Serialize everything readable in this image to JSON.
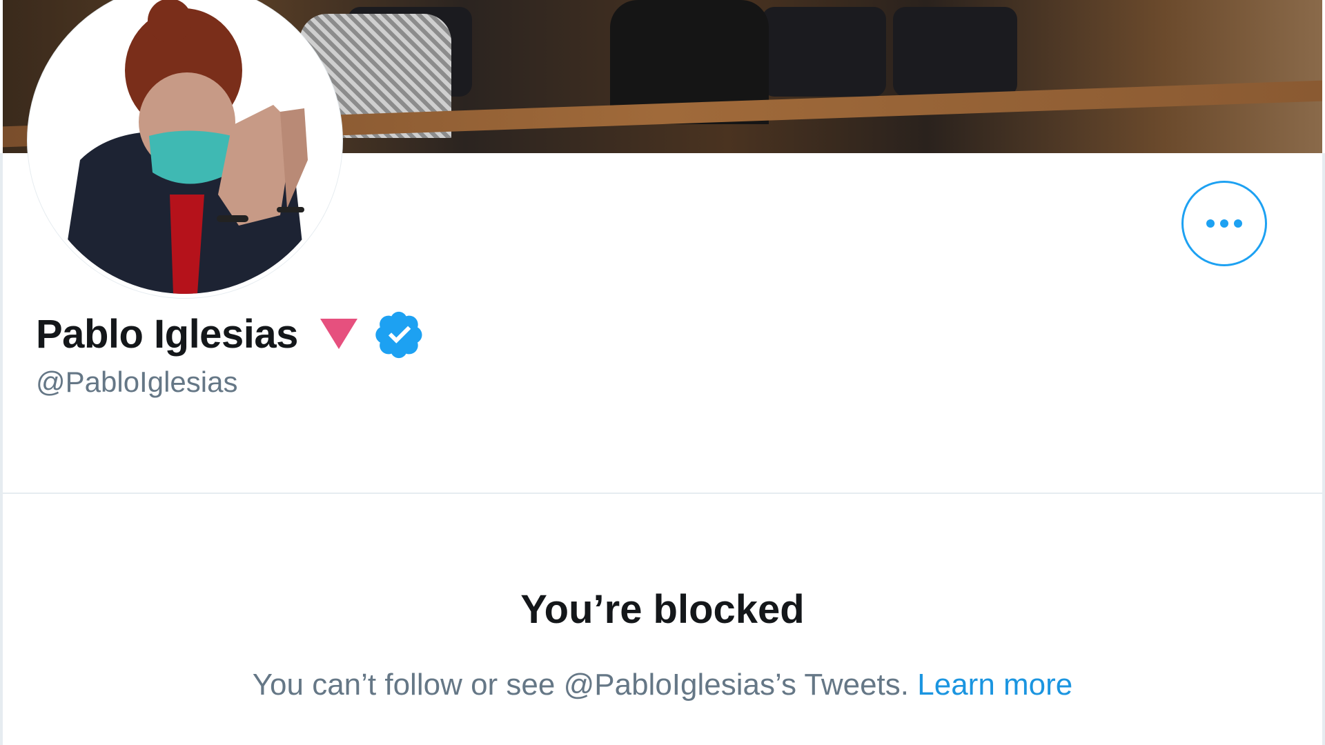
{
  "profile": {
    "name": "Pablo Iglesias",
    "handle": "@PabloIglesias",
    "more_icon": "more-horizontal-icon",
    "verified_icon": "verified-badge-icon",
    "emoji_icon": "red-triangle-down-icon"
  },
  "blocked": {
    "title": "You’re blocked",
    "message": "You can’t follow or see @PabloIglesias’s Tweets.",
    "link": "Learn more"
  },
  "colors": {
    "accent": "#1da1f2",
    "link": "#1b95e0",
    "text_primary": "#14171a",
    "text_secondary": "#657786",
    "triangle": "#e0245e"
  }
}
